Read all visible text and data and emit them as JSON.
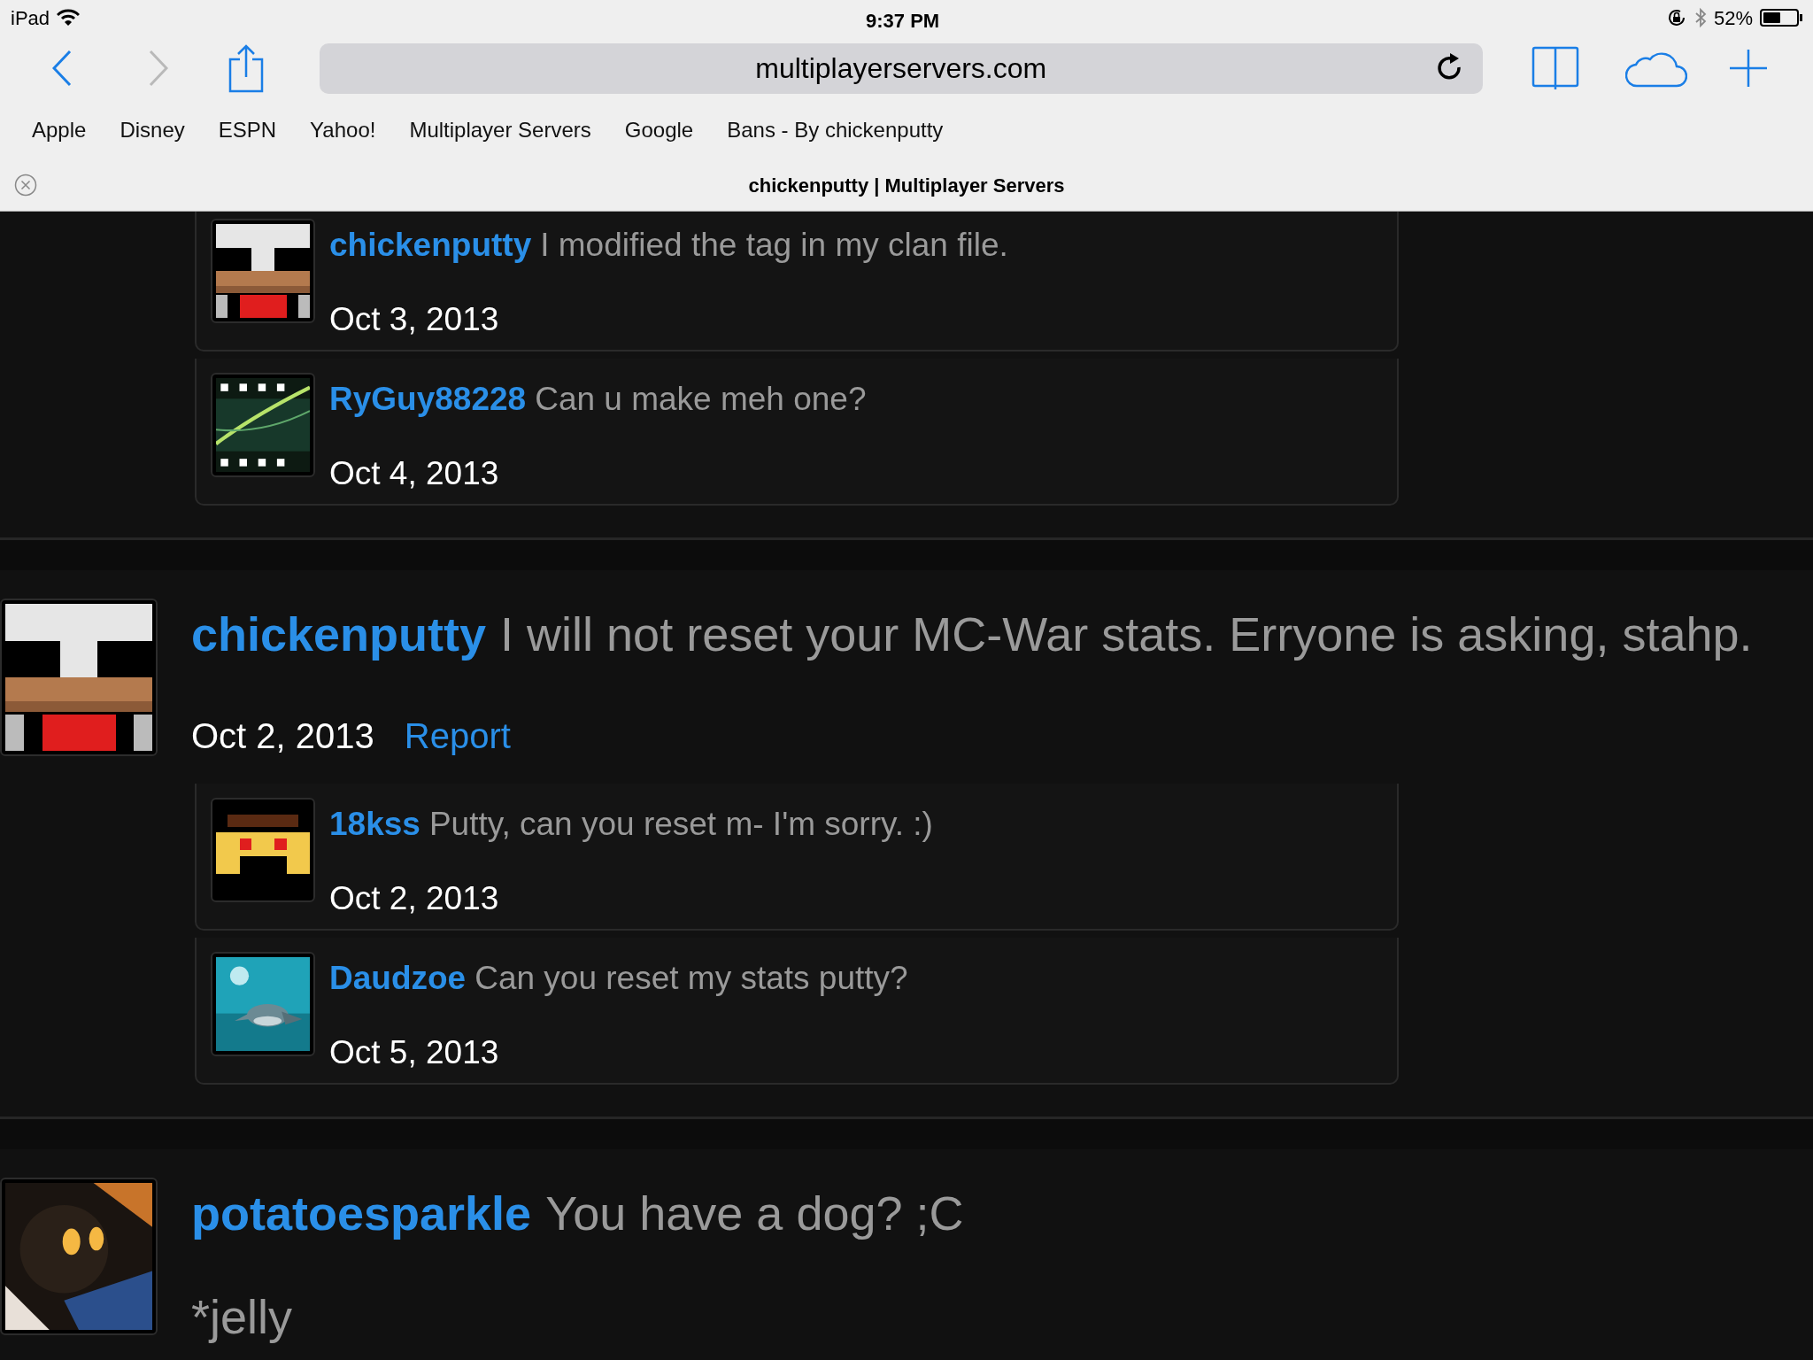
{
  "status_bar": {
    "device": "iPad",
    "time": "9:37 PM",
    "battery": {
      "text": "52%",
      "level": 0.52
    }
  },
  "toolbar": {
    "url": "multiplayerservers.com"
  },
  "bookmarks": [
    "Apple",
    "Disney",
    "ESPN",
    "Yahoo!",
    "Multiplayer Servers",
    "Google",
    "Bans - By chickenputty"
  ],
  "tab_title": "chickenputty | Multiplayer Servers",
  "posts": [
    {
      "replies": [
        {
          "author": "chickenputty",
          "message": "I modified the tag in my clan file.",
          "date": "Oct 3, 2013",
          "avatar": {
            "kind": "chicken"
          }
        },
        {
          "author": "RyGuy88228",
          "message": "Can u make meh one?",
          "date": "Oct 4, 2013",
          "avatar": {
            "kind": "film"
          }
        }
      ]
    },
    {
      "author": "chickenputty",
      "message": "I will not reset your MC-War stats. Erryone is asking, stahp.",
      "date": "Oct 2, 2013",
      "report": "Report",
      "avatar": {
        "kind": "chicken"
      },
      "replies": [
        {
          "author": "18kss",
          "message": "Putty, can you reset m- I'm sorry. :)",
          "date": "Oct 2, 2013",
          "avatar": {
            "kind": "face"
          }
        },
        {
          "author": "Daudzoe",
          "message": "Can you reset my stats putty?",
          "date": "Oct 5, 2013",
          "avatar": {
            "kind": "dolphin"
          }
        }
      ]
    },
    {
      "author": "potatoesparkle",
      "message": "You have a dog? ;C",
      "continuation": "*jelly",
      "avatar": {
        "kind": "dark"
      }
    }
  ]
}
